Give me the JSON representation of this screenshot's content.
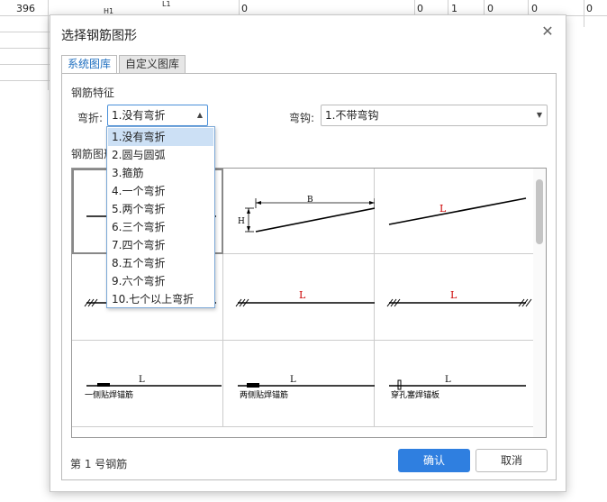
{
  "background": {
    "row_number": "396",
    "cells": [
      "H1",
      "L1",
      "0",
      "0",
      "1",
      "0",
      "0",
      "0"
    ]
  },
  "dialog": {
    "title": "选择钢筋图形",
    "close_icon": "close-icon"
  },
  "tabs": [
    {
      "label": "系统图库",
      "active": true
    },
    {
      "label": "自定义图库",
      "active": false
    }
  ],
  "features": {
    "section_title": "钢筋特征",
    "bend_label": "弯折:",
    "bend_value": "1.没有弯折",
    "hook_label": "弯钩:",
    "hook_value": "1.不带弯钩"
  },
  "shapes": {
    "section_title": "钢筋图形",
    "labels": {
      "B": "B",
      "H": "H",
      "L": "L",
      "one_side_anchor": "一侧贴焊锚筋",
      "two_side_anchor": "两侧贴焊锚筋",
      "plug_weld": "穿孔塞焊锚板"
    }
  },
  "bend_options": [
    "1.没有弯折",
    "2.圆与圆弧",
    "3.箍筋",
    "4.一个弯折",
    "5.两个弯折",
    "6.三个弯折",
    "7.四个弯折",
    "8.五个弯折",
    "9.六个弯折",
    "10.七个以上弯折"
  ],
  "footer": {
    "rebar_number_text": "第 1 号钢筋",
    "confirm_label": "确认",
    "cancel_label": "取消"
  },
  "colors": {
    "accent": "#2f7fe0",
    "highlight": "#cce0f5",
    "red_label": "#cc0000"
  }
}
